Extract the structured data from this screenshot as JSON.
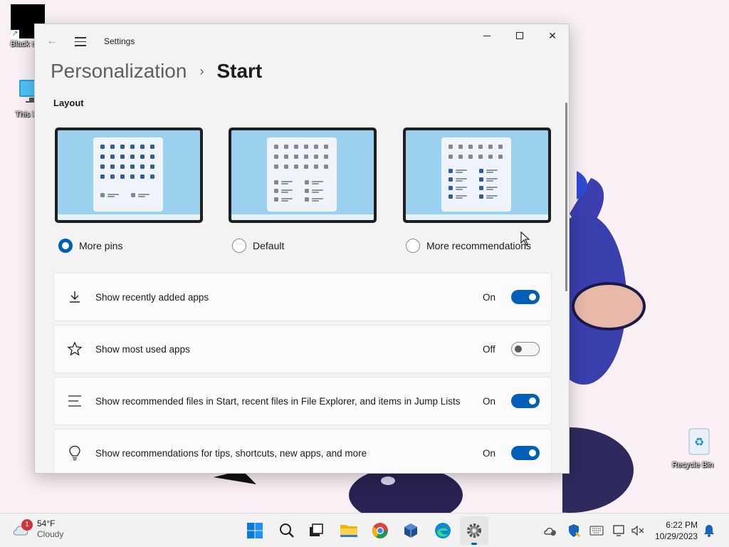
{
  "desktop": {
    "icons": [
      {
        "label": "Black sc"
      },
      {
        "label": "This P"
      },
      {
        "label": "Recycle Bin"
      }
    ]
  },
  "window": {
    "title": "Settings",
    "breadcrumb": {
      "parent": "Personalization",
      "separator": "›",
      "current": "Start"
    },
    "section_label": "Layout",
    "layout_options": [
      {
        "label": "More pins",
        "selected": true
      },
      {
        "label": "Default",
        "selected": false
      },
      {
        "label": "More recommendations",
        "selected": false
      }
    ],
    "settings": [
      {
        "label": "Show recently added apps",
        "state": "On",
        "icon": "download-icon"
      },
      {
        "label": "Show most used apps",
        "state": "Off",
        "icon": "star-icon"
      },
      {
        "label": "Show recommended files in Start, recent files in File Explorer, and items in Jump Lists",
        "state": "On",
        "icon": "list-icon"
      },
      {
        "label": "Show recommendations for tips, shortcuts, new apps, and more",
        "state": "On",
        "icon": "lightbulb-icon"
      }
    ]
  },
  "taskbar": {
    "weather": {
      "temp": "54°F",
      "condition": "Cloudy",
      "badge": "1"
    },
    "apps": [
      "start-icon",
      "search-icon",
      "task-view-icon",
      "file-explorer-icon",
      "chrome-icon",
      "virtualbox-icon",
      "edge-icon",
      "settings-icon"
    ],
    "clock": {
      "time": "6:22 PM",
      "date": "10/29/2023"
    }
  },
  "colors": {
    "accent": "#005fb8",
    "preview_bg": "#9bd1ee"
  }
}
